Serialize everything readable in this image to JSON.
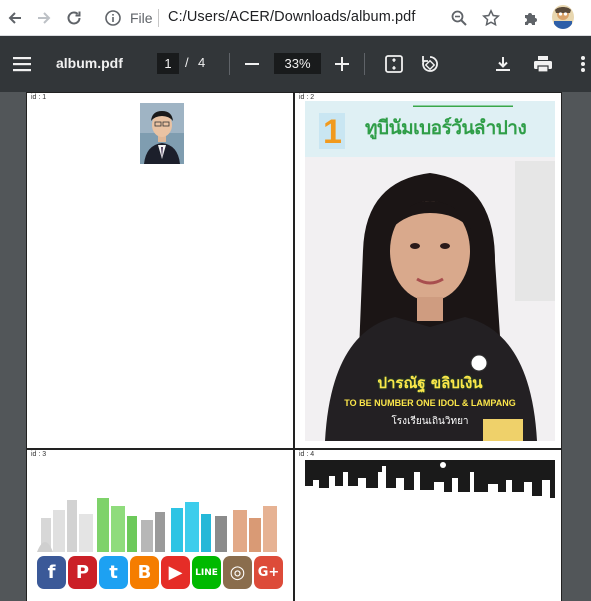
{
  "browser": {
    "url_scheme": "File",
    "url_path": "C:/Users/ACER/Downloads/album.pdf"
  },
  "toolbar": {
    "title": "album.pdf",
    "current_page": "1",
    "page_separator": "/",
    "total_pages": "4",
    "zoom": "33%"
  },
  "pages": [
    {
      "id_label": "id : 1"
    },
    {
      "id_label": "id : 2",
      "headline": "ทูบีนัมเบอร์วันลำปาง",
      "name": "ปารณัฐ ขลิบเงิน",
      "caption": "TO BE NUMBER ONE IDOL & LAMPANG",
      "school": "โรงเรียนเถินวิทยา"
    },
    {
      "id_label": "id : 3"
    },
    {
      "id_label": "id : 4"
    }
  ],
  "social_icons": [
    "facebook-icon",
    "pinterest-icon",
    "twitter-icon",
    "blogger-icon",
    "youtube-icon",
    "line-icon",
    "instagram-icon",
    "google-plus-icon"
  ],
  "colors": {
    "toolbar": "#323639",
    "viewer": "#525659",
    "accent_green": "#3aa74a"
  }
}
